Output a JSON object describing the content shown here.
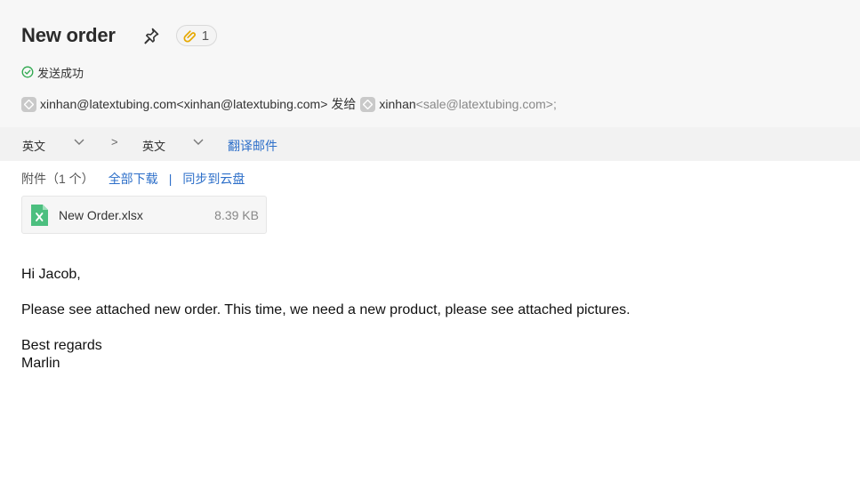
{
  "header": {
    "subject": "New order",
    "attachment_badge_count": "1",
    "status_text": "发送成功",
    "sender": "xinhan@latextubing.com<xinhan@latextubing.com>",
    "sent_to_label": "发给",
    "recipient_name": "xinhan",
    "recipient_email": "<sale@latextubing.com>;"
  },
  "translate": {
    "source_lang": "英文",
    "arrow": ">",
    "target_lang": "英文",
    "translate_label": "翻译邮件"
  },
  "attachments": {
    "label": "附件（1 个）",
    "download_all": "全部下载",
    "separator": "|",
    "sync_cloud": "同步到云盘",
    "files": [
      {
        "name": "New Order.xlsx",
        "size": "8.39 KB",
        "icon": "excel-file-icon"
      }
    ]
  },
  "body": {
    "greeting": "Hi Jacob,",
    "paragraph": "Please see attached new order. This time, we need a new product, please see attached pictures.",
    "closing": "Best regards",
    "signature": "Marlin"
  },
  "colors": {
    "link": "#2d6fc9",
    "success": "#2fa84f",
    "header_bg": "#f7f7f7",
    "translate_bar_bg": "#f2f2f2",
    "excel_green": "#4cbf7f",
    "badge_icon": "#e6a800"
  }
}
